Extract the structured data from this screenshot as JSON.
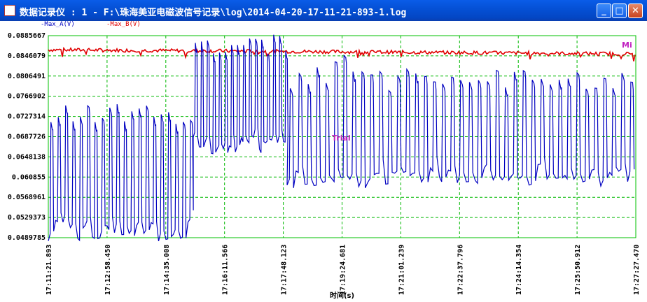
{
  "window": {
    "title": "数据记录仪 : 1 - F:\\珠海美亚电磁波信号记录\\log\\2014-04-20-17-11-21-893-1.log",
    "minimize_icon": "minimize-icon",
    "maximize_icon": "maximize-icon",
    "close_icon": "close-icon"
  },
  "legend": {
    "series_a": "Max_A(V)",
    "series_b": "Max_B(V)"
  },
  "markers": {
    "trial": "Trial",
    "corner": "Mi"
  },
  "colors": {
    "series_a": "#0000c0",
    "series_b": "#e00000",
    "grid": "#00b800",
    "axis_box": "#00c000",
    "marker": "#c020c0"
  },
  "chart_data": {
    "type": "line",
    "xlabel": "时间(s)",
    "ylabel": "",
    "ylim": [
      0.0489785,
      0.0885667
    ],
    "y_ticks": [
      "0.0885667",
      "0.0846079",
      "0.0806491",
      "0.0766902",
      "0.0727314",
      "0.0687726",
      "0.0648138",
      "0.060855",
      "0.0568961",
      "0.0529373",
      "0.0489785"
    ],
    "x_ticks": [
      "17:11:21.893",
      "17:12:58.450",
      "17:14:35.008",
      "17:16:11.566",
      "17:17:48.123",
      "17:19:24.681",
      "17:21:01.239",
      "17:22:37.796",
      "17:24:14.354",
      "17:25:50.912",
      "17:27:27.470"
    ],
    "grid": true,
    "series": [
      {
        "name": "Max_A(V)",
        "description_segments": [
          {
            "from": "17:11:21.893",
            "to": "17:14:50",
            "low": 0.0495,
            "high": 0.0725
          },
          {
            "from": "17:14:50",
            "to": "17:18:30",
            "low": 0.0665,
            "high": 0.0865
          },
          {
            "from": "17:18:30",
            "to": "17:27:27.470",
            "low": 0.0585,
            "high": 0.0815
          }
        ]
      },
      {
        "name": "Max_B(V)",
        "description_segments": [
          {
            "from": "17:11:21.893",
            "to": "17:27:27.470",
            "start": 0.0858,
            "end": 0.0852
          }
        ]
      }
    ]
  }
}
